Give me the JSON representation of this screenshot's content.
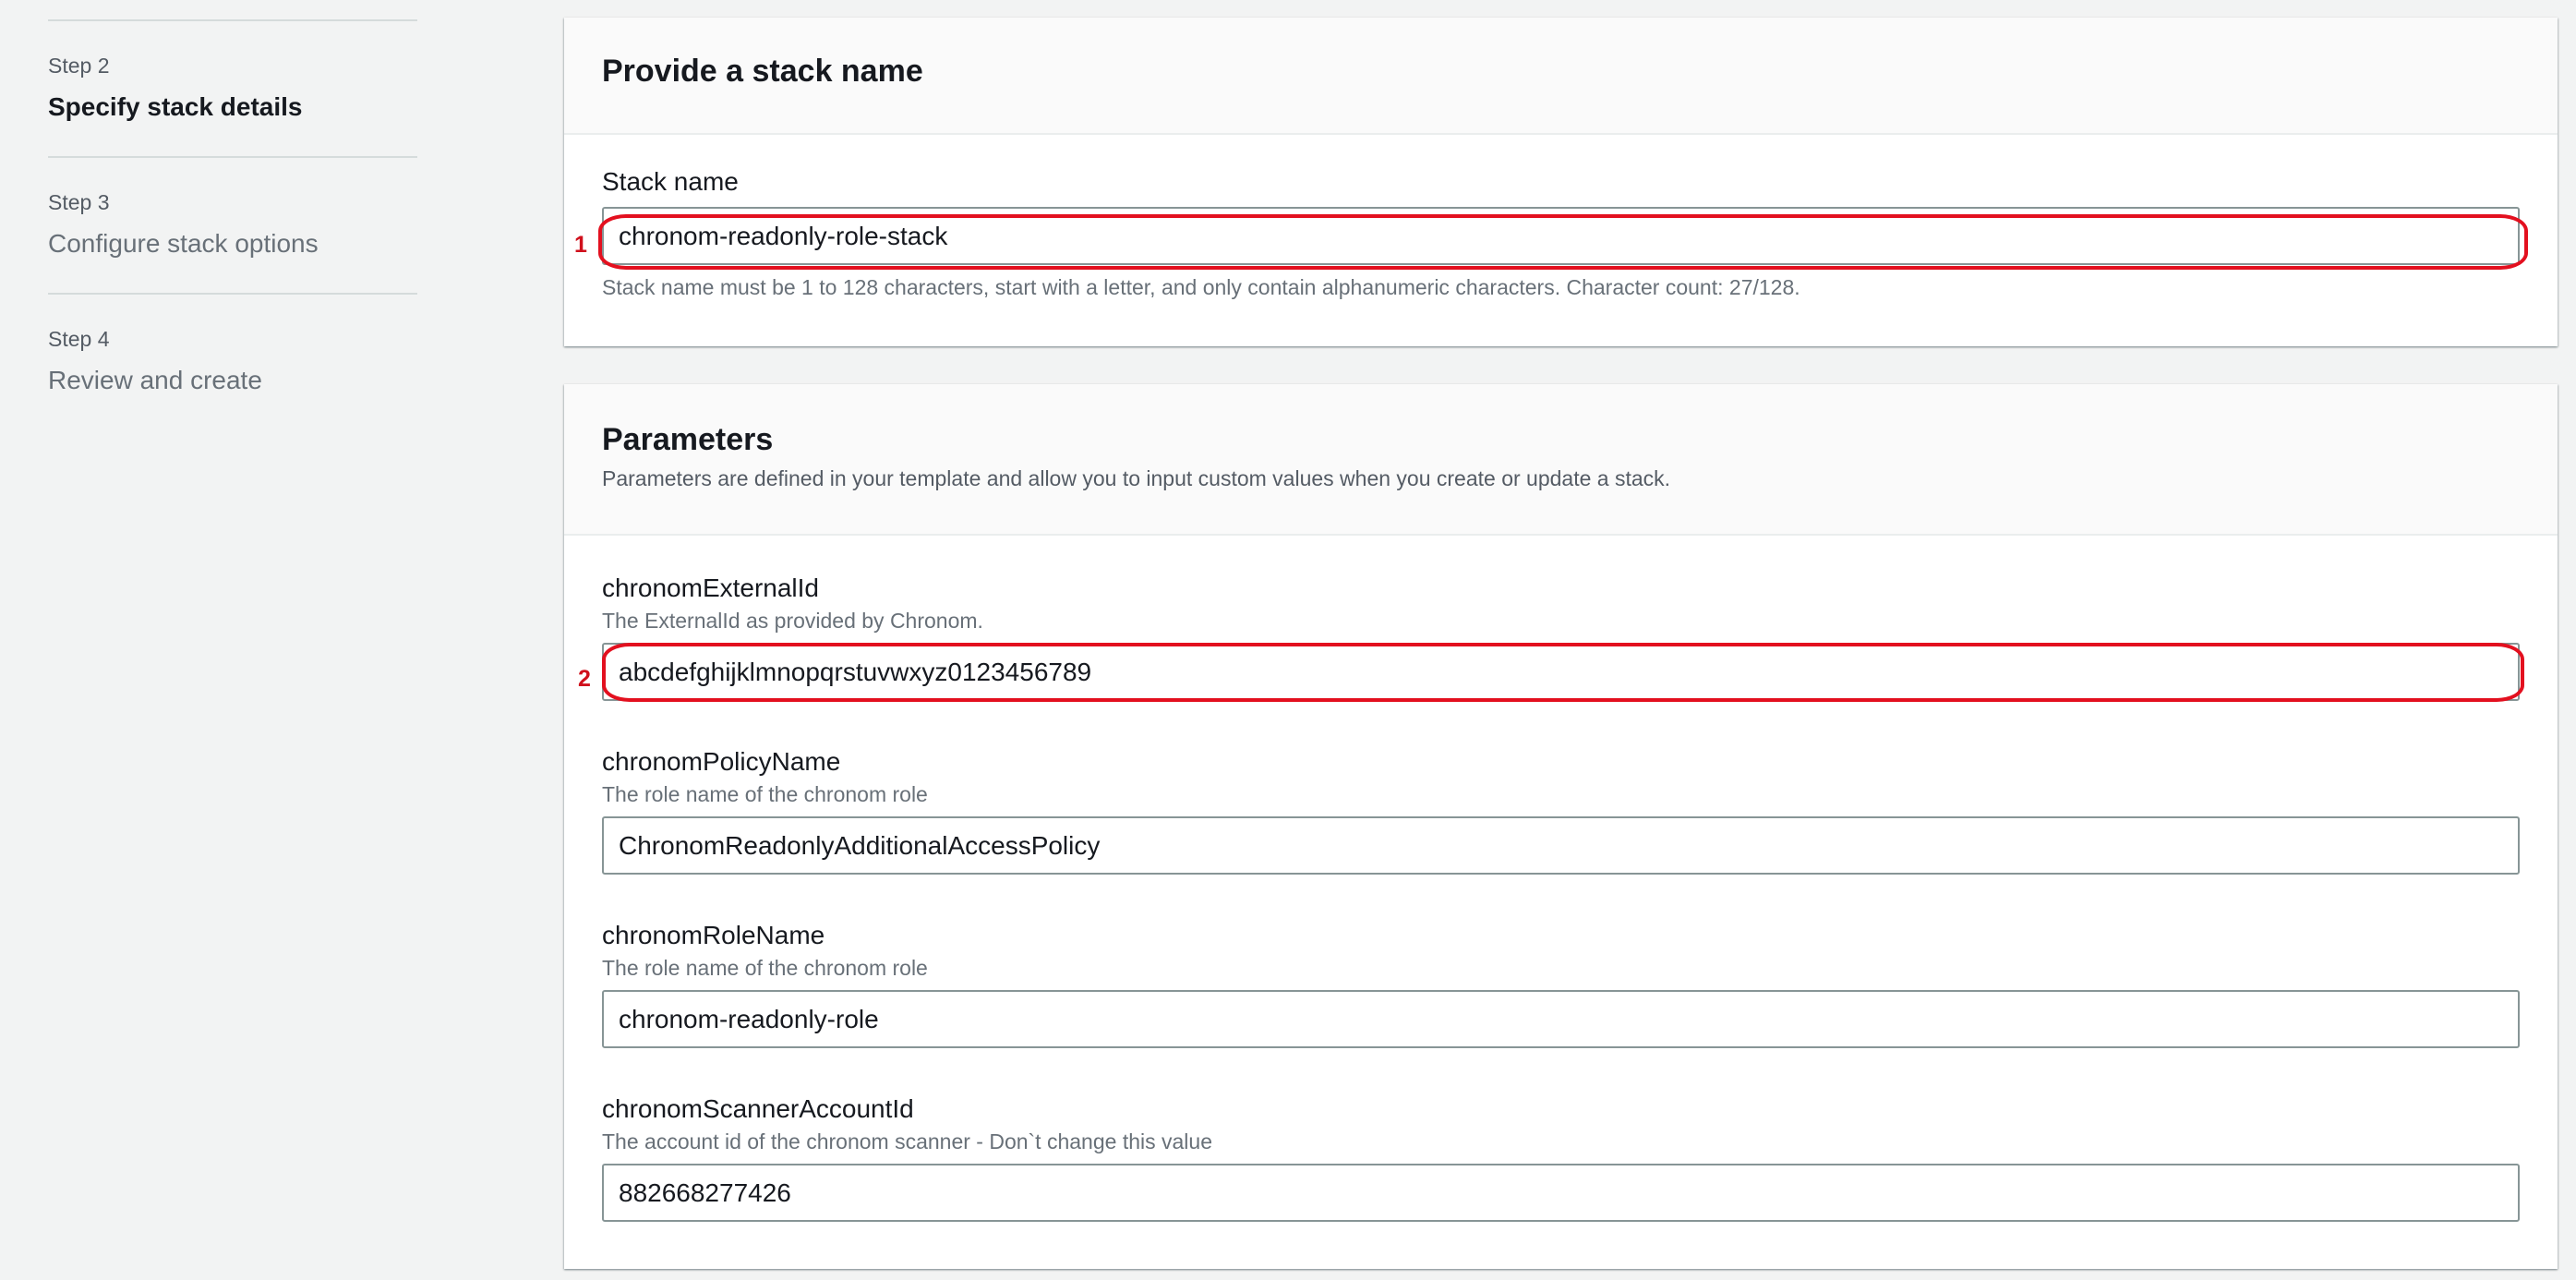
{
  "steps": [
    {
      "number": "Step 2",
      "title": "Specify stack details",
      "active": true
    },
    {
      "number": "Step 3",
      "title": "Configure stack options",
      "active": false
    },
    {
      "number": "Step 4",
      "title": "Review and create",
      "active": false
    }
  ],
  "stack_panel": {
    "title": "Provide a stack name",
    "field_label": "Stack name",
    "field_value": "chronom-readonly-role-stack",
    "constraint": "Stack name must be 1 to 128 characters, start with a letter, and only contain alphanumeric characters. Character count: 27/128.",
    "annotation": "1"
  },
  "params_panel": {
    "title": "Parameters",
    "description": "Parameters are defined in your template and allow you to input custom values when you create or update a stack.",
    "fields": [
      {
        "label": "chronomExternalId",
        "description": "The ExternalId as provided by Chronom.",
        "value": "abcdefghijklmnopqrstuvwxyz0123456789",
        "annotation": "2"
      },
      {
        "label": "chronomPolicyName",
        "description": "The role name of the chronom role",
        "value": "ChronomReadonlyAdditionalAccessPolicy"
      },
      {
        "label": "chronomRoleName",
        "description": "The role name of the chronom role",
        "value": "chronom-readonly-role"
      },
      {
        "label": "chronomScannerAccountId",
        "description": "The account id of the chronom scanner - Don`t change this value",
        "value": "882668277426"
      }
    ]
  },
  "colors": {
    "annotation_red": "#e3101f",
    "page_background": "#f2f3f3"
  }
}
